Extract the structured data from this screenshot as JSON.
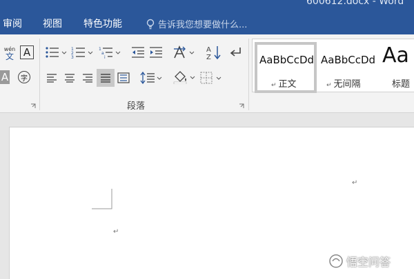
{
  "window": {
    "title": "600612.docx - Word"
  },
  "tabs": [
    {
      "label": "审阅"
    },
    {
      "label": "视图"
    },
    {
      "label": "特色功能"
    }
  ],
  "tell_me": {
    "text": "告诉我您想要做什么..."
  },
  "ribbon": {
    "font_partial": {
      "phonetic_top": "wén",
      "phonetic_bottom": "文",
      "char_border": "A",
      "char_shading": "A",
      "enclose": "字"
    },
    "paragraph_group_label": "段落",
    "styles": [
      {
        "sample": "AaBbCcDd",
        "name": "正文",
        "mark": "↵",
        "selected": true
      },
      {
        "sample": "AaBbCcDd",
        "name": "无间隔",
        "mark": "↵",
        "selected": false
      },
      {
        "sample": "Aa",
        "name": "标题"
      }
    ]
  },
  "document": {
    "paragraph_mark_1": "↵",
    "paragraph_mark_2": "↵"
  },
  "watermark": {
    "text": "悟空问答"
  },
  "colors": {
    "titlebar": "#2b579a",
    "ribbon": "#f3f3f3",
    "workspace": "#e6e6e6",
    "page": "#ffffff",
    "icon_blue": "#2b579a"
  }
}
